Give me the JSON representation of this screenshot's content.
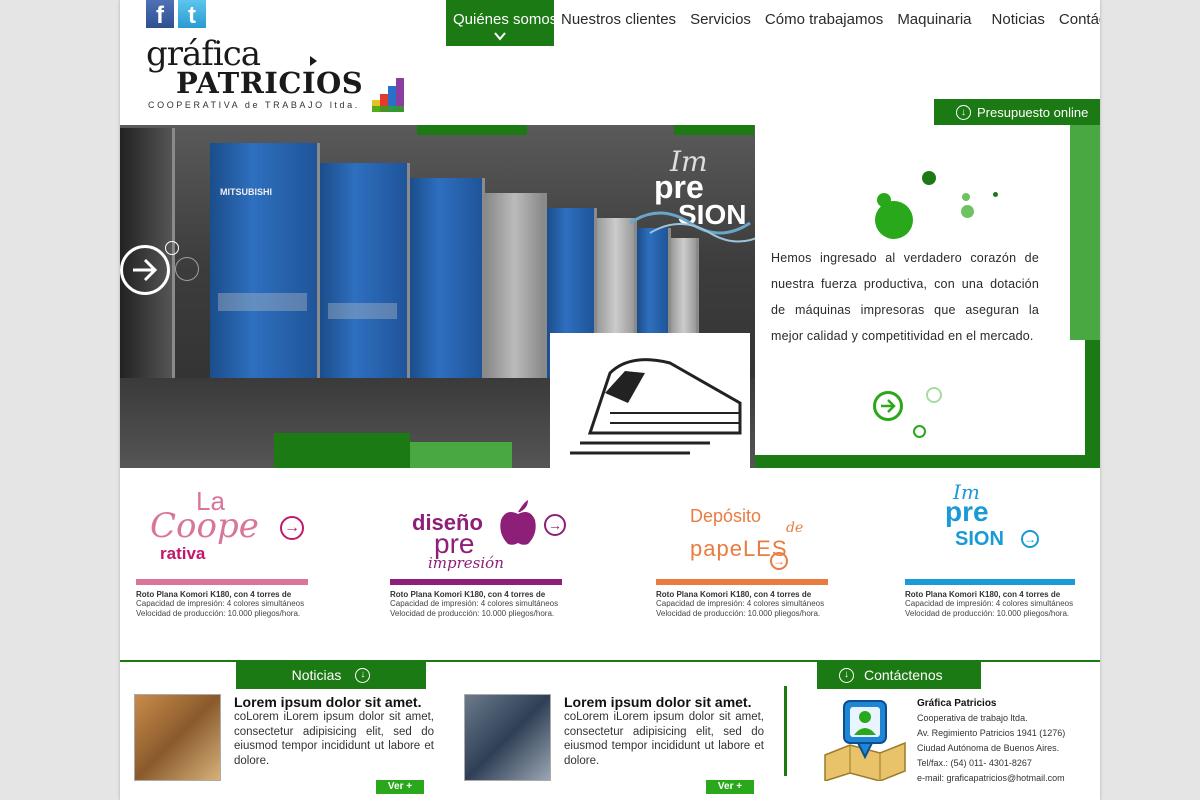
{
  "social": {
    "facebook_icon": "facebook-icon",
    "twitter_icon": "twitter-icon"
  },
  "logo": {
    "line1": "gráfica",
    "line2": "PATRICIOS",
    "line3": "COOPERATIVA de TRABAJO ltda."
  },
  "nav": {
    "items": [
      {
        "label": "Quiénes somos",
        "active": true
      },
      {
        "label": "Nuestros clientes"
      },
      {
        "label": "Servicios"
      },
      {
        "label": "Cómo trabajamos"
      },
      {
        "label": "Maquinaria"
      },
      {
        "label": "Noticias"
      },
      {
        "label": "Contáctenos"
      }
    ]
  },
  "presupuesto": {
    "label": "Presupuesto online"
  },
  "hero": {
    "badge": {
      "im": "Im",
      "pre": "pre",
      "sion": "SION"
    },
    "text": "Hemos ingresado al verdadero corazón de nuestra fuerza productiva, con una dotación de máquinas impresoras que aseguran la mejor calidad y competitividad en el mercado."
  },
  "cards": [
    {
      "art_top": "La",
      "art_mid": "Coope",
      "art_bottom": "rativa",
      "title": "Roto Plana Komori K180, con 4 torres de",
      "line1": "Capacidad de impresión: 4 colores simultáneos",
      "line2": "Velocidad de producción: 10.000 pliegos/hora.",
      "color": "#d9759b"
    },
    {
      "art_top": "diseño",
      "art_mid": "pre",
      "art_bottom": "impresión",
      "title": "Roto Plana Komori K180, con 4 torres de",
      "line1": "Capacidad de impresión: 4 colores simultáneos",
      "line2": "Velocidad de producción: 10.000 pliegos/hora.",
      "color": "#8e1f78"
    },
    {
      "art_top": "Depósito",
      "art_mid": "de",
      "art_bottom": "papeLES",
      "title": "Roto Plana Komori K180, con 4 torres de",
      "line1": "Capacidad de impresión: 4 colores simultáneos",
      "line2": "Velocidad de producción: 10.000 pliegos/hora.",
      "color": "#e87c41"
    },
    {
      "art_top": "Im",
      "art_mid": "pre",
      "art_bottom": "SION",
      "title": "Roto Plana Komori K180, con 4 torres de",
      "line1": "Capacidad de impresión: 4 colores simultáneos",
      "line2": "Velocidad de producción: 10.000 pliegos/hora.",
      "color": "#1a9ad6"
    }
  ],
  "noticias": {
    "tab_label": "Noticias",
    "items": [
      {
        "title": "Lorem ipsum dolor sit amet.",
        "body": "coLorem iLorem ipsum dolor sit amet, consectetur adipisicing elit, sed do eiusmod tempor incididunt ut labore et dolore.",
        "more": "Ver +"
      },
      {
        "title": "Lorem ipsum dolor sit amet.",
        "body": "coLorem iLorem ipsum dolor sit amet, consectetur adipisicing elit, sed do eiusmod tempor incididunt ut labore et dolore.",
        "more": "Ver +"
      }
    ]
  },
  "contacto": {
    "tab_label": "Contáctenos",
    "name": "Gráfica Patricios",
    "line1": "Cooperativa de trabajo ltda.",
    "line2": "Av. Regimiento Patricios 1941 (1276)",
    "line3": "Ciudad Autónoma de Buenos Aires.",
    "line4": "Tel/fax.: (54) 011- 4301-8267",
    "line5": "e-mail: graficapatricios@hotmail.com"
  },
  "colors": {
    "brand_green": "#1c7a14",
    "light_green": "#4aa843",
    "button_green": "#2aa81c"
  }
}
